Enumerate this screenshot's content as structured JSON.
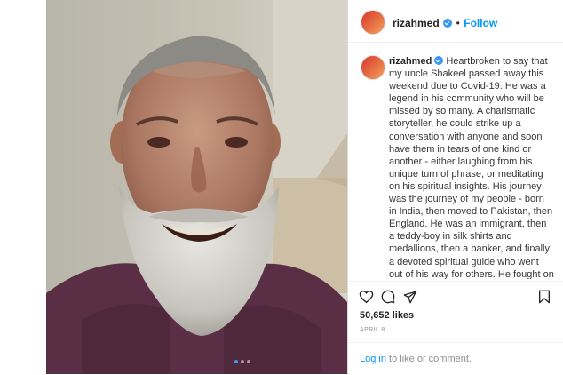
{
  "post": {
    "username": "rizahmed",
    "follow_label": "Follow",
    "separator": "•",
    "caption_text": "Heartbroken to say that my uncle Shakeel passed away this weekend due to Covid-19. He was a legend in his community who will be missed by so many. A charismatic storyteller, he could strike up a conversation with anyone and soon have them in tears of one kind or another - either laughing from his unique turn of phrase, or meditating on his spiritual insights. His journey was the journey of my people - born in India, then moved to Pakistan, then England. He was an immigrant, then a teddy-boy in silk shirts and medallions, then a banker, and finally a devoted spiritual guide who went out of his way for others. He fought on til the end, outliving multiple terminal diagnoses for years, and",
    "likes": "50,652 likes",
    "date": "APRIL 8",
    "login_link": "Log in",
    "login_rest": " to like or comment."
  },
  "carousel": {
    "slide_count": 3,
    "active_index": 0
  },
  "icons": {
    "like": "heart-icon",
    "comment": "comment-icon",
    "share": "share-icon",
    "save": "bookmark-icon",
    "next": "chevron-right-icon",
    "verified": "verified-badge-icon"
  },
  "colors": {
    "accent": "#0095f6",
    "verified": "#3897f0",
    "text": "#262626",
    "muted": "#8e8e8e"
  }
}
